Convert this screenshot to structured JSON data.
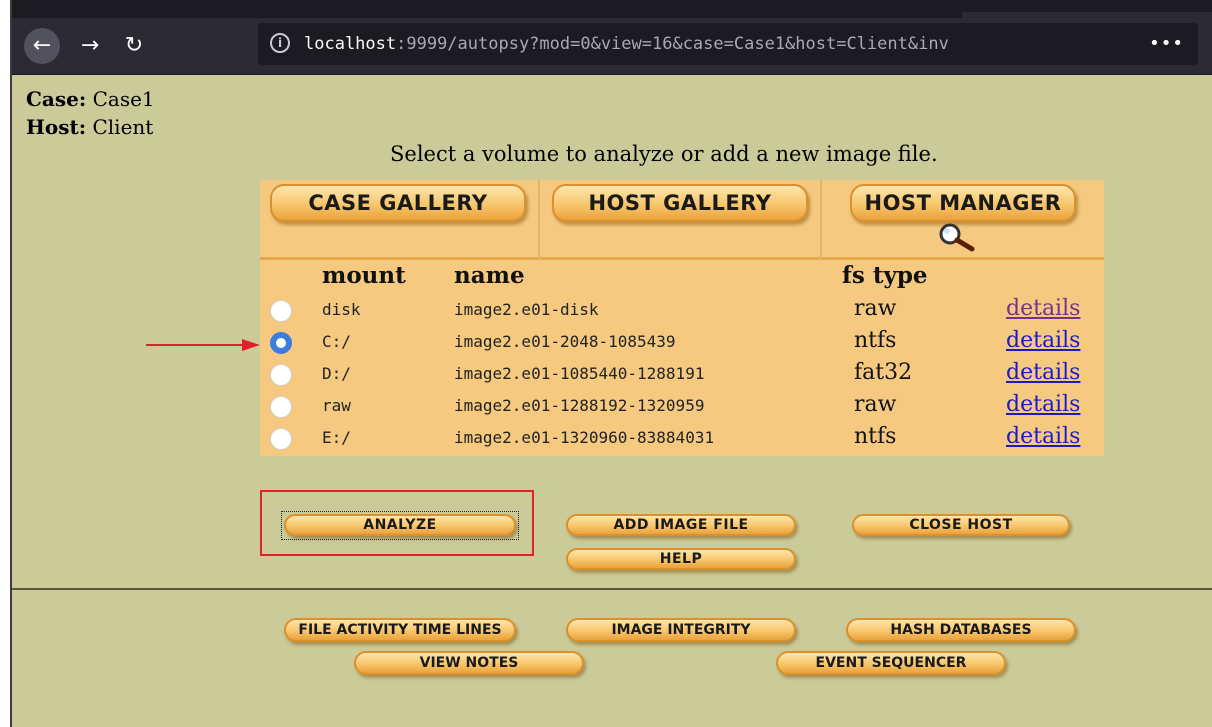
{
  "browser": {
    "url_host": "localhost",
    "url_rest": ":9999/autopsy?mod=0&view=16&case=Case1&host=Client&inv",
    "more_label": "•••"
  },
  "info": {
    "case_label": "Case:",
    "case_value": "Case1",
    "host_label": "Host:",
    "host_value": "Client"
  },
  "instruction": "Select a volume to analyze or add a new image file.",
  "gallery_tabs": [
    "CASE GALLERY",
    "HOST GALLERY",
    "HOST MANAGER"
  ],
  "table": {
    "headers": {
      "mount": "mount",
      "name": "name",
      "fs_type": "fs type"
    },
    "rows": [
      {
        "mount": "disk",
        "name": "image2.e01-disk",
        "fs": "raw",
        "details": "details",
        "selected": false
      },
      {
        "mount": "C:/",
        "name": "image2.e01-2048-1085439",
        "fs": "ntfs",
        "details": "details",
        "selected": true
      },
      {
        "mount": "D:/",
        "name": "image2.e01-1085440-1288191",
        "fs": "fat32",
        "details": "details",
        "selected": false
      },
      {
        "mount": "raw",
        "name": "image2.e01-1288192-1320959",
        "fs": "raw",
        "details": "details",
        "selected": false
      },
      {
        "mount": "E:/",
        "name": "image2.e01-1320960-83884031",
        "fs": "ntfs",
        "details": "details",
        "selected": false
      }
    ]
  },
  "actions": {
    "analyze": "ANALYZE",
    "add_image": "ADD IMAGE FILE",
    "close_host": "CLOSE HOST",
    "help": "HELP"
  },
  "bottom_buttons": {
    "file_activity": "FILE ACTIVITY TIME LINES",
    "image_integrity": "IMAGE INTEGRITY",
    "hash_databases": "HASH DATABASES",
    "view_notes": "VIEW NOTES",
    "event_sequencer": "EVENT SEQUENCER"
  },
  "colors": {
    "page_bg": "#cacb98",
    "panel_bg": "#f5c97f",
    "button_orange": "#f7c66b",
    "link_blue": "#1b1bcc",
    "annotation_red": "#e0202a",
    "radio_selected": "#3b7ddd"
  }
}
